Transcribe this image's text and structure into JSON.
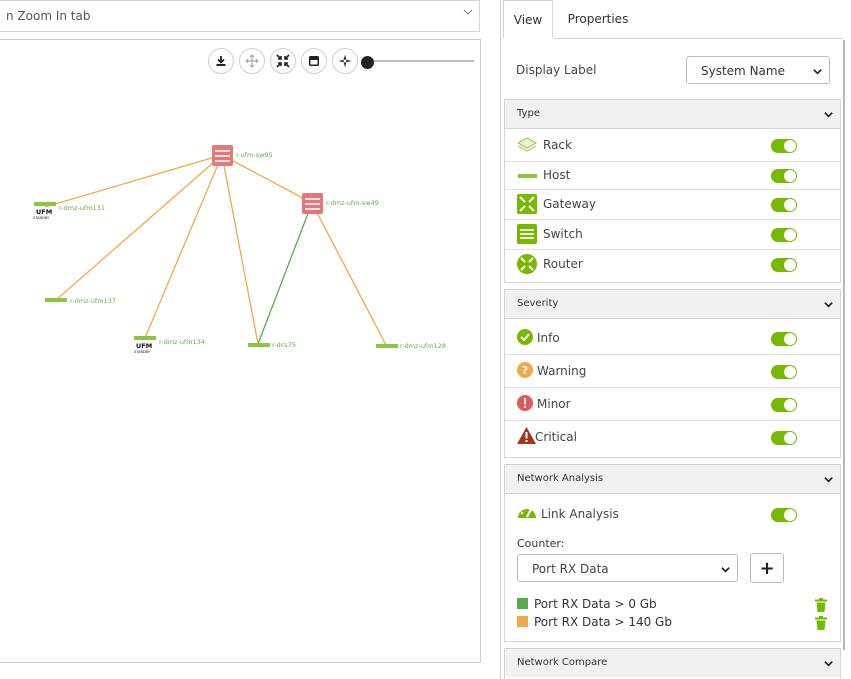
{
  "topology": {
    "dropdown_text": "n Zoom In tab",
    "nodes": {
      "sw95": "r-ufm-sw95",
      "sw49": "r-dmz-ufm-sw49",
      "ufm131": "r-dmz-ufm131",
      "ufm137": "r-dmz-ufm137",
      "ufm134": "r-dmz-ufm134",
      "dcs75": "r-dcs75",
      "ufm128": "r-dmz-ufm128"
    },
    "ufm_badge": "UFM",
    "standby_badge": "STANDBY",
    "toolbar": [
      "download-icon",
      "move-icon",
      "collapse-icon",
      "window-icon",
      "navigate-icon"
    ],
    "colors": {
      "link_orange": "#f0a94a",
      "link_green": "#5bab4e",
      "switch": "#e07a7a",
      "host": "#8cc63f"
    }
  },
  "panel": {
    "tabs": [
      "View",
      "Properties"
    ],
    "active_tab": "View",
    "display_label": {
      "label": "Display Label",
      "value": "System Name"
    },
    "type": {
      "title": "Type",
      "items": [
        {
          "label": "Rack",
          "icon": "rack-icon",
          "on": true
        },
        {
          "label": "Host",
          "icon": "host-icon",
          "on": true
        },
        {
          "label": "Gateway",
          "icon": "gateway-icon",
          "on": true
        },
        {
          "label": "Switch",
          "icon": "switch-icon",
          "on": true
        },
        {
          "label": "Router",
          "icon": "router-icon",
          "on": true
        }
      ]
    },
    "severity": {
      "title": "Severity",
      "items": [
        {
          "label": "Info",
          "icon": "info-check-icon",
          "color": "#76b900",
          "on": true
        },
        {
          "label": "Warning",
          "icon": "warning-question-icon",
          "color": "#f0a94a",
          "on": true
        },
        {
          "label": "Minor",
          "icon": "minor-exclamation-icon",
          "color": "#e05a5a",
          "on": true
        },
        {
          "label": "Critical",
          "icon": "critical-triangle-icon",
          "color": "#a8321a",
          "on": true
        }
      ]
    },
    "network_analysis": {
      "title": "Network Analysis",
      "link_analysis": "Link Analysis",
      "counter_label": "Counter:",
      "counter_value": "Port RX Data",
      "add_symbol": "+",
      "legend": [
        {
          "label": "Port RX Data > 0 Gb",
          "color": "#5bab4e"
        },
        {
          "label": "Port RX Data > 140 Gb",
          "color": "#f0a94a"
        }
      ]
    },
    "network_compare": {
      "title": "Network Compare"
    },
    "accent": "#76b900"
  }
}
